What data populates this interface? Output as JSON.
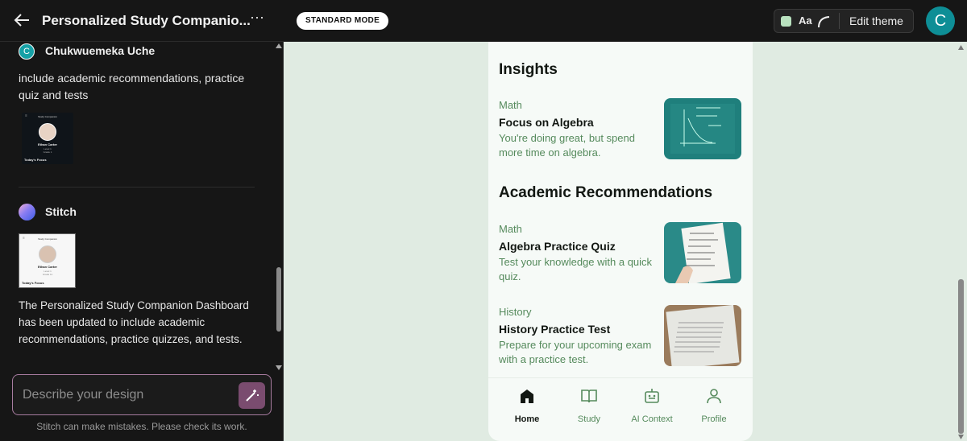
{
  "header": {
    "title": "Personalized Study Companio...",
    "mode": "STANDARD MODE",
    "theme_font": "Aa",
    "edit_theme": "Edit theme",
    "avatar_letter": "C"
  },
  "chat": {
    "user": {
      "initial": "C",
      "name": "Chukwuemeka Uche",
      "message": "include academic recommendations, practice quiz and tests"
    },
    "assistant": {
      "name": "Stitch",
      "message": "The Personalized Study Companion Dashboard has been updated to include academic recommendations, practice quizzes, and tests."
    },
    "thumb1": {
      "title": "Study Companion",
      "name": "Ethan Carter",
      "line1": "Level 1",
      "line2": "Grade 1",
      "footer": "Today's Focus"
    },
    "thumb2": {
      "title": "Study Companion",
      "name": "Ethan Carter",
      "line1": "Level 1",
      "line2": "Grade 11",
      "footer": "Today's Focus"
    },
    "input_placeholder": "Describe your design",
    "disclaimer": "Stitch can make mistakes. Please check its work."
  },
  "preview": {
    "insights_title": "Insights",
    "insights": [
      {
        "category": "Math",
        "title": "Focus on Algebra",
        "desc": "You're doing great, but spend more time on algebra."
      }
    ],
    "recommendations_title": "Academic Recommendations",
    "recommendations": [
      {
        "category": "Math",
        "title": "Algebra Practice Quiz",
        "desc": "Test your knowledge with a quick quiz."
      },
      {
        "category": "History",
        "title": "History Practice Test",
        "desc": "Prepare for your upcoming exam with a practice test."
      }
    ],
    "nav": [
      {
        "label": "Home"
      },
      {
        "label": "Study"
      },
      {
        "label": "AI Context"
      },
      {
        "label": "Profile"
      }
    ]
  },
  "colors": {
    "accent": "#0e8e96",
    "green_text": "#558a5c",
    "bg": "#e0ebe2"
  }
}
